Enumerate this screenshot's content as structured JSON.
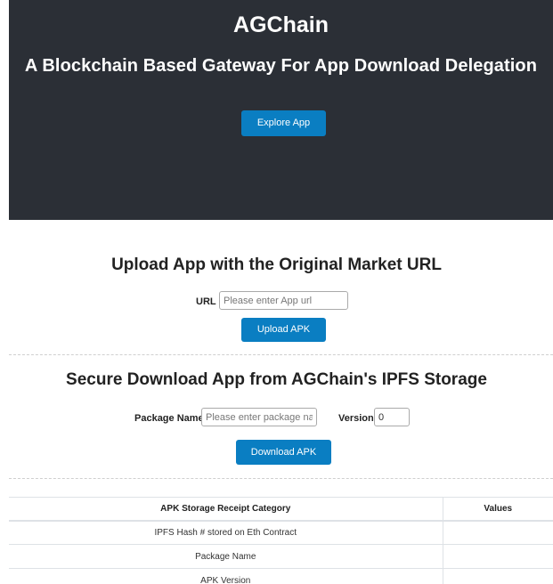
{
  "hero": {
    "title": "AGChain",
    "subtitle": "A Blockchain Based Gateway For App Download Delegation",
    "explore_button": "Explore App",
    "background_color": "#2b2f36"
  },
  "upload": {
    "title": "Upload App with the Original Market URL",
    "url_label": "URL",
    "url_placeholder": "Please enter App url",
    "url_value": "",
    "button": "Upload APK"
  },
  "download": {
    "title": "Secure Download App from AGChain's IPFS Storage",
    "package_label": "Package Name",
    "package_placeholder": "Please enter package name",
    "package_value": "",
    "version_label": "Version",
    "version_value": "0",
    "button": "Download APK"
  },
  "receipt_table": {
    "headers": [
      "APK Storage Receipt Category",
      "Values"
    ],
    "rows": [
      {
        "category": "IPFS Hash # stored on Eth Contract",
        "value": ""
      },
      {
        "category": "Package Name",
        "value": ""
      },
      {
        "category": "APK Version",
        "value": ""
      }
    ]
  },
  "colors": {
    "accent": "#0a7ec2"
  }
}
